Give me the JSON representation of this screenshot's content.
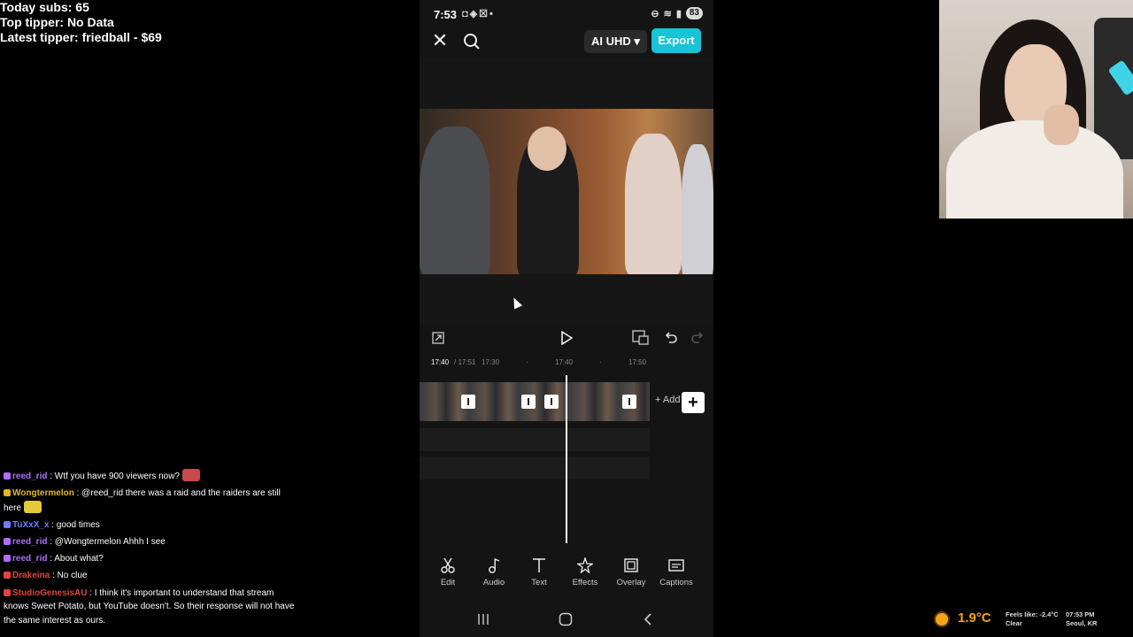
{
  "stream_stats": {
    "today_subs": "Today subs: 65",
    "top_tipper": "Top tipper: No Data",
    "latest_tipper": "Latest tipper: friedball - $69"
  },
  "phone": {
    "status": {
      "time": "7:53",
      "battery": "83"
    },
    "topbar": {
      "quality_label": "AI UHD",
      "export_label": "Export"
    },
    "timeline": {
      "current_time": "17:40",
      "total_time": "/ 17:51",
      "ticks": [
        "17:30",
        "17:40",
        "17:50"
      ]
    },
    "add_label": "+ Add",
    "toolbar": [
      {
        "label": "Edit",
        "icon": "scissors-icon"
      },
      {
        "label": "Audio",
        "icon": "music-note-icon"
      },
      {
        "label": "Text",
        "icon": "text-icon"
      },
      {
        "label": "Effects",
        "icon": "sparkle-icon"
      },
      {
        "label": "Overlay",
        "icon": "overlay-icon"
      },
      {
        "label": "Captions",
        "icon": "captions-icon"
      }
    ]
  },
  "chat": [
    {
      "name": "reed_rid",
      "name_color": "#b06cff",
      "message": ": Wtf you have 900 viewers now?",
      "emote": true
    },
    {
      "name": "Wongtermelon",
      "name_color": "#e6b422",
      "message": ": @reed_rid there was a raid and the raiders are still here",
      "emote": true
    },
    {
      "name": "TuXxX_x",
      "name_color": "#6b7cff",
      "message": ": good times",
      "emote": false
    },
    {
      "name": "reed_rid",
      "name_color": "#b06cff",
      "message": ": @Wongtermelon Ahhh I see",
      "emote": false
    },
    {
      "name": "reed_rid",
      "name_color": "#b06cff",
      "message": ": About what?",
      "emote": false
    },
    {
      "name": "Drakeina",
      "name_color": "#e0443c",
      "message": ": No clue",
      "emote": false
    },
    {
      "name": "StudioGenesisAU",
      "name_color": "#e0443c",
      "message": ": I think it's important to understand that stream knows Sweet Potato, but YouTube doesn't. So their response will not have the same interest as ours.",
      "emote": false
    }
  ],
  "weather": {
    "temperature": "1.9°C",
    "feels_like": "Feels like: -2.4°C",
    "condition": "Clear",
    "time": "07:53 PM",
    "location": "Seoul, KR"
  }
}
